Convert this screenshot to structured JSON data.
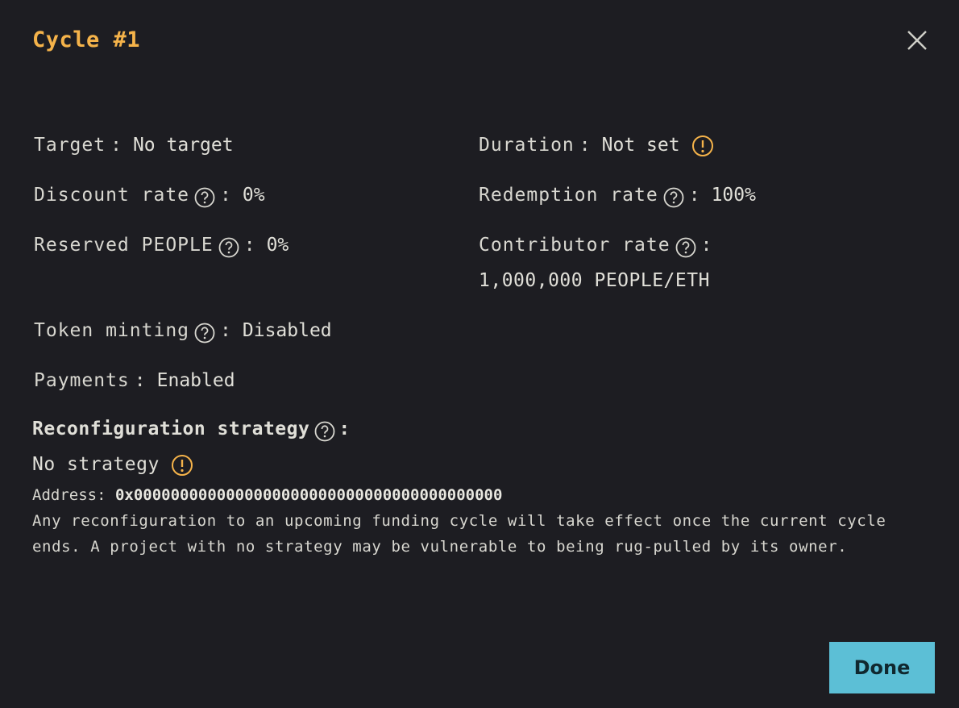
{
  "modal": {
    "title": "Cycle #1",
    "done_label": "Done"
  },
  "fields": {
    "target": {
      "label": "Target",
      "value": "No target"
    },
    "duration": {
      "label": "Duration",
      "value": "Not set"
    },
    "discount_rate": {
      "label": "Discount rate",
      "value": "0%"
    },
    "redemption_rate": {
      "label": "Redemption rate",
      "value": "100%"
    },
    "reserved": {
      "label": "Reserved PEOPLE",
      "value": "0%"
    },
    "contributor_rate": {
      "label": "Contributor rate",
      "value": "1,000,000 PEOPLE/ETH"
    },
    "token_minting": {
      "label": "Token minting",
      "value": "Disabled"
    },
    "payments": {
      "label": "Payments",
      "value": "Enabled"
    }
  },
  "strategy": {
    "heading": "Reconfiguration strategy",
    "name": "No strategy",
    "address_label": "Address:",
    "address": "0x0000000000000000000000000000000000000000",
    "note": "Any reconfiguration to an upcoming funding cycle will take effect once the current cycle ends. A project with no strategy may be vulnerable to being rug-pulled by its owner."
  },
  "colors": {
    "background": "#1d1d22",
    "accent": "#f5b34a",
    "button": "#5cbfd6",
    "text": "#e0dfd8"
  },
  "icons": {
    "help": "question-circle-icon",
    "warning": "exclamation-circle-icon",
    "close": "close-icon"
  }
}
